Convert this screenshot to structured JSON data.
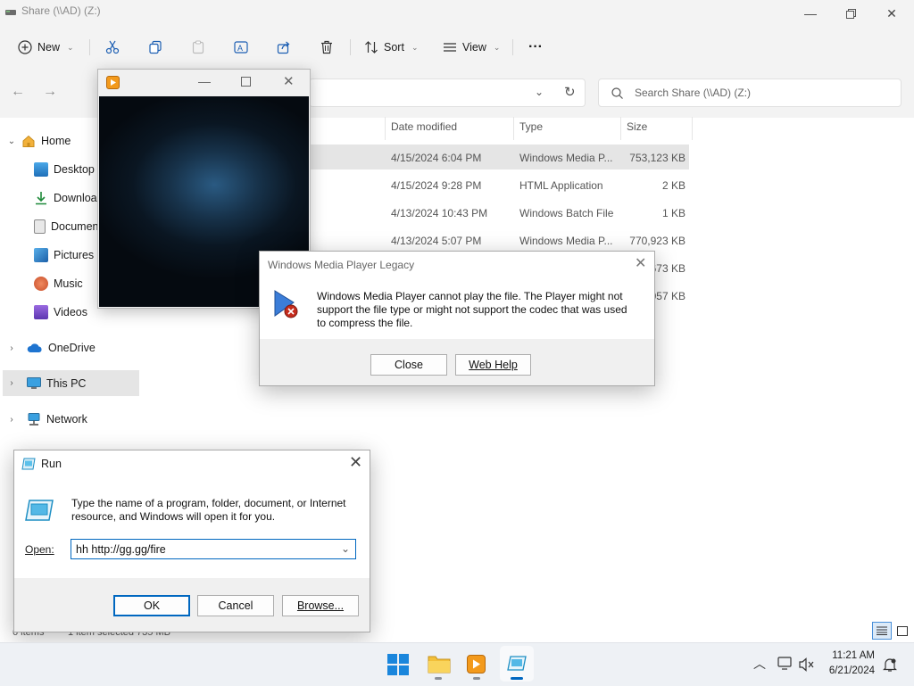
{
  "explorer": {
    "title": "Share (\\\\AD) (Z:)",
    "toolbar": {
      "new": "New",
      "sort": "Sort",
      "view": "View",
      "more": "···"
    },
    "search_placeholder": "Search Share (\\\\AD) (Z:)",
    "nav": {
      "home": "Home",
      "desktop": "Desktop",
      "downloads": "Downloads",
      "documents": "Documents",
      "pictures": "Pictures",
      "music": "Music",
      "videos": "Videos",
      "onedrive": "OneDrive",
      "thispc": "This PC",
      "network": "Network"
    },
    "columns": {
      "date": "Date modified",
      "type": "Type",
      "size": "Size"
    },
    "rows": [
      {
        "date": "4/15/2024 6:04 PM",
        "type": "Windows Media P...",
        "size": "753,123 KB"
      },
      {
        "date": "4/15/2024 9:28 PM",
        "type": "HTML Application",
        "size": "2 KB"
      },
      {
        "date": "4/13/2024 10:43 PM",
        "type": "Windows Batch File",
        "size": "1 KB"
      },
      {
        "date": "4/13/2024 5:07 PM",
        "type": "Windows Media P...",
        "size": "770,923 KB"
      },
      {
        "size": "673 KB"
      },
      {
        "size": "057 KB"
      }
    ],
    "status": {
      "items": "6 items",
      "selected": "1 item selected  735 MB"
    }
  },
  "wmp_dialog": {
    "title": "Windows Media Player Legacy",
    "message": "Windows Media Player cannot play the file. The Player might not support the file type or might not support the codec that was used to compress the file.",
    "close_label": "Close",
    "webhelp_label": "Web Help"
  },
  "run_dialog": {
    "title": "Run",
    "description": "Type the name of a program, folder, document, or Internet resource, and Windows will open it for you.",
    "open_label": "Open:",
    "open_value": "hh http://gg.gg/fire",
    "ok_label": "OK",
    "cancel_label": "Cancel",
    "browse_label": "Browse..."
  },
  "taskbar": {
    "time": "11:21 AM",
    "date": "6/21/2024"
  },
  "colors": {
    "accent": "#0067c0",
    "selection": "#e5e5e5",
    "error_red": "#c42b1c"
  }
}
